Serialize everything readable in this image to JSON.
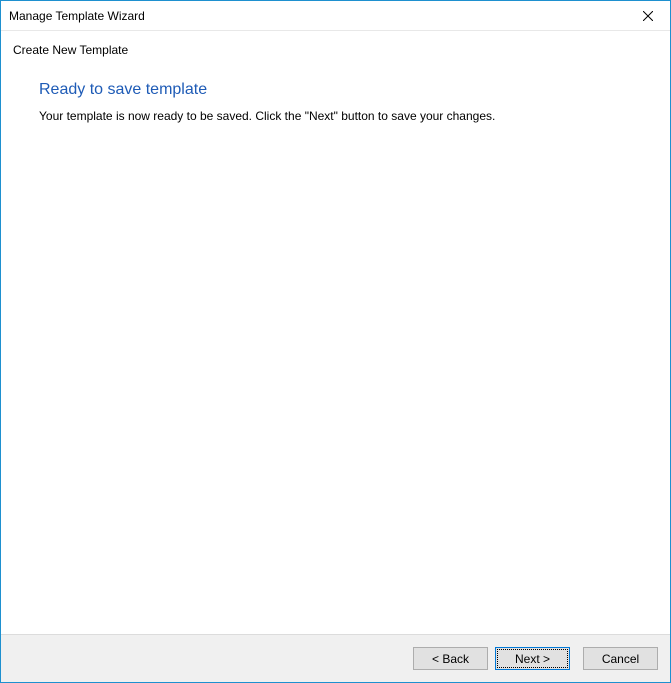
{
  "titlebar": {
    "title": "Manage Template Wizard"
  },
  "subtitle": "Create New Template",
  "content": {
    "heading": "Ready to save template",
    "description": "Your template is now ready to be saved. Click the \"Next\" button to save your changes."
  },
  "footer": {
    "back_label": "< Back",
    "next_label": "Next >",
    "cancel_label": "Cancel"
  }
}
